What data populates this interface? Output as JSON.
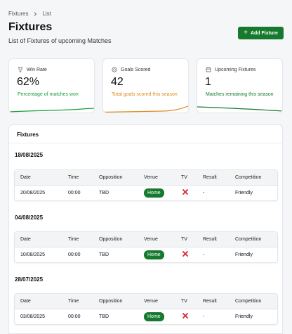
{
  "breadcrumb": {
    "items": [
      "Fixtures",
      "List"
    ]
  },
  "page": {
    "title": "Fixtures",
    "subtitle": "List of Fixtures of upcoming Matches"
  },
  "actions": {
    "add_label": "Add Fixture"
  },
  "stats": [
    {
      "icon": "trophy-icon",
      "label": "Win Rate",
      "value": "62%",
      "desc": "Percentage of matches won",
      "color": "#1a9c3a"
    },
    {
      "icon": "ball-icon",
      "label": "Goals Scored",
      "value": "42",
      "desc": "Total goals scored this season",
      "color": "#e08a1e"
    },
    {
      "icon": "calendar-icon",
      "label": "Upcoming Fixtures",
      "value": "1",
      "desc": "Matches remaining this season",
      "color": "#157a2e"
    }
  ],
  "fixtures_panel": {
    "title": "Fixtures",
    "columns": [
      "Date",
      "Time",
      "Opposition",
      "Venue",
      "TV",
      "Result",
      "Competition"
    ],
    "groups": [
      {
        "date": "18/08/2025",
        "row": {
          "date": "20/08/2025",
          "time": "00:00",
          "opposition": "TBD",
          "venue": "Home",
          "tv": "x-icon",
          "result": "-",
          "competition": "Friendly"
        }
      },
      {
        "date": "04/08/2025",
        "row": {
          "date": "10/08/2025",
          "time": "00:00",
          "opposition": "TBD",
          "venue": "Home",
          "tv": "x-icon",
          "result": "-",
          "competition": "Friendly"
        }
      },
      {
        "date": "28/07/2025",
        "row": {
          "date": "03/08/2025",
          "time": "00:00",
          "opposition": "TBD",
          "venue": "Home",
          "tv": "x-icon",
          "result": "-",
          "competition": "Friendly"
        }
      }
    ]
  },
  "colors": {
    "brand": "#157a2e",
    "badge": "#157a2e",
    "tv_no": "#d9232e"
  }
}
